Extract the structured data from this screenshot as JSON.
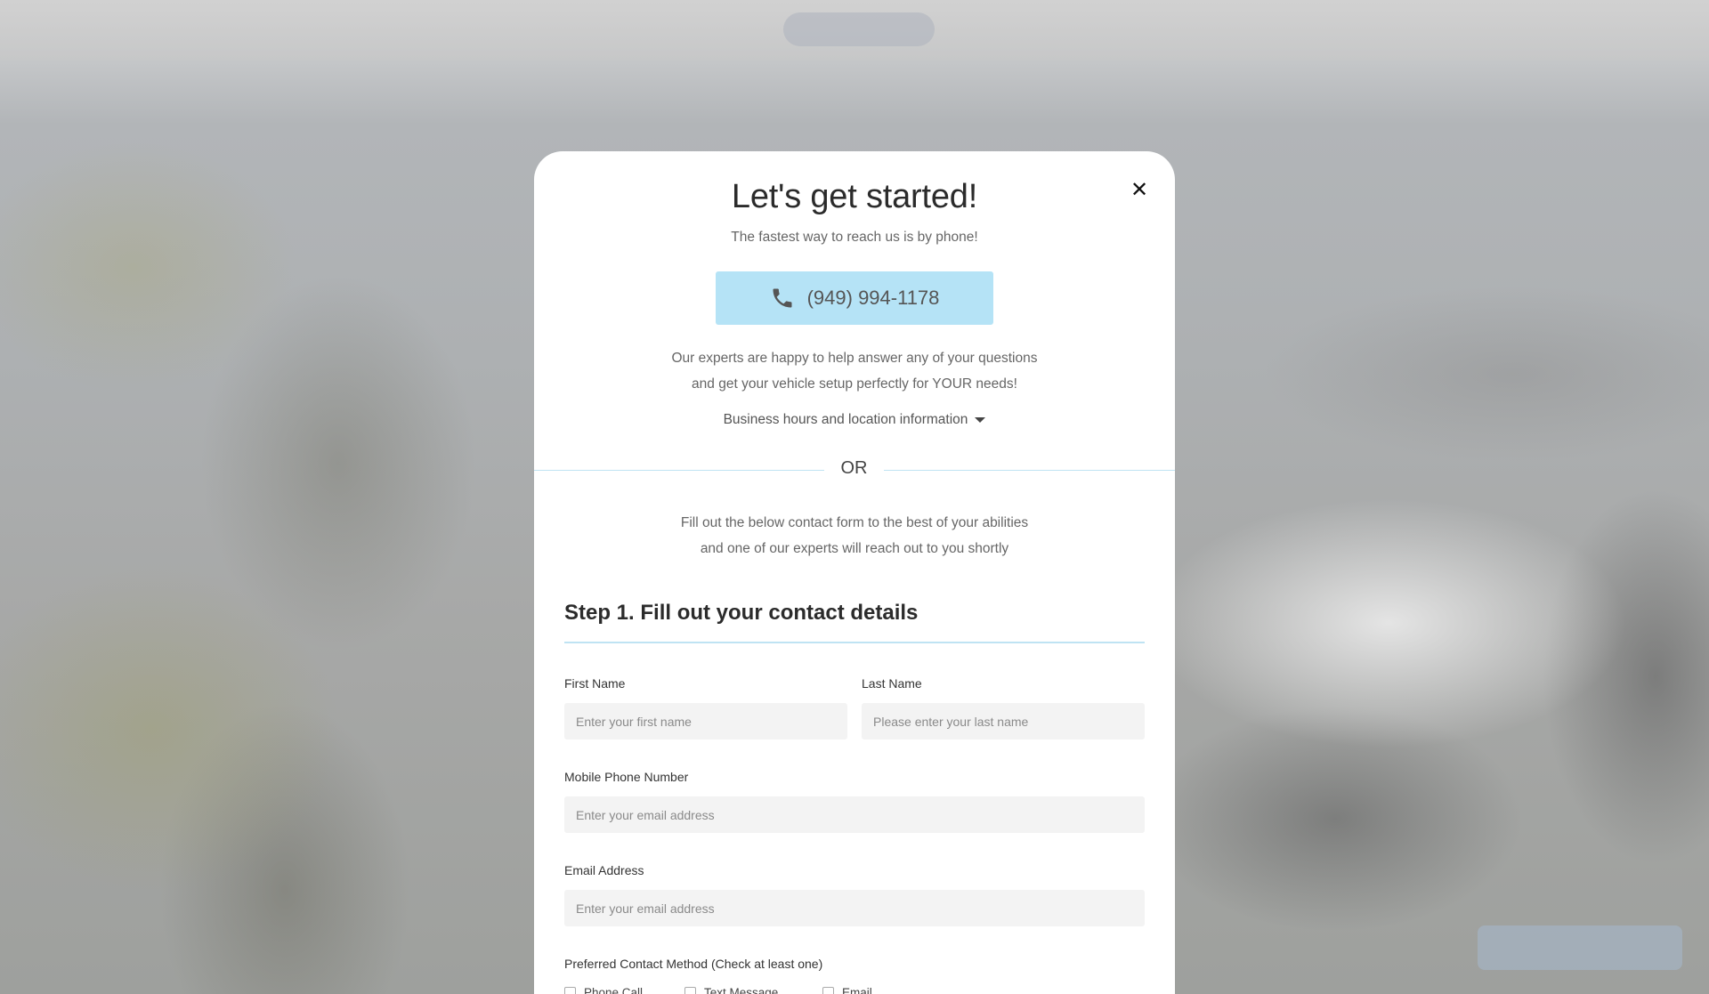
{
  "modal": {
    "title": "Let's get started!",
    "subtitle": "The fastest way to reach us is by phone!",
    "phone_number": "(949) 994-1178",
    "intro_line1": "Our experts are happy to help answer any of your questions",
    "intro_line2": "and get your vehicle setup perfectly for YOUR needs!",
    "hours_toggle": "Business hours and location information",
    "or_label": "OR",
    "form_intro_line1": "Fill out the below contact form to the best of your abilities",
    "form_intro_line2": "and one of our experts will reach out to you shortly",
    "close_icon": "close-icon",
    "phone_icon": "phone-icon"
  },
  "form": {
    "step_heading": "Step 1. Fill out your contact details",
    "first_name": {
      "label": "First Name",
      "placeholder": "Enter your first name",
      "value": ""
    },
    "last_name": {
      "label": "Last Name",
      "placeholder": "Please enter your last name",
      "value": ""
    },
    "mobile_phone": {
      "label": "Mobile Phone Number",
      "placeholder": "Enter your email address",
      "value": ""
    },
    "email": {
      "label": "Email Address",
      "placeholder": "Enter your email address",
      "value": ""
    },
    "contact_method": {
      "label": "Preferred Contact Method (Check at least one)",
      "options": [
        "Phone Call",
        "Text Message",
        "Email"
      ]
    }
  },
  "colors": {
    "phone_button_bg": "#b5e3f6",
    "divider": "#bfe3f3",
    "input_bg": "#f3f3f3"
  }
}
